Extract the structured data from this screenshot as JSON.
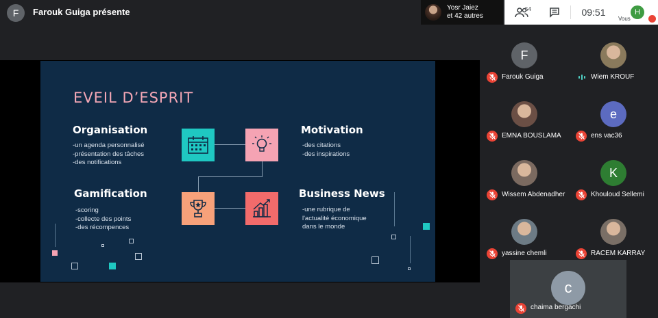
{
  "header": {
    "presenter_initial": "F",
    "presenter_text": "Farouk Guiga présente",
    "people_chip": {
      "line1": "Yosr Jaiez",
      "line2": "et 42 autres"
    },
    "participant_count": "54",
    "clock": "09:51",
    "self": {
      "initial": "H",
      "label": "Vous"
    }
  },
  "slide": {
    "title": "EVEIL D’ESPRIT",
    "sections": [
      {
        "title": "Organisation",
        "lines": [
          "-un agenda personnalisé",
          "-présentation des tâches",
          "-des notifications"
        ]
      },
      {
        "title": "Motivation",
        "lines": [
          "-des citations",
          "-des inspirations"
        ]
      },
      {
        "title": "Gamification",
        "lines": [
          "-scoring",
          "-collecte des points",
          "-des récompences"
        ]
      },
      {
        "title": "Business News",
        "lines": [
          "-une rubrique de",
          "l'actualité économique",
          "dans le monde"
        ]
      }
    ]
  },
  "participants": [
    {
      "name": "Farouk Guiga",
      "initial": "F",
      "avatar_color": "#5f6368",
      "muted": true
    },
    {
      "name": "Wiem KROUF",
      "initial": "",
      "avatar_color": "#8a7a5c",
      "muted": false
    },
    {
      "name": "EMNA BOUSLAMA",
      "initial": "",
      "avatar_color": "#6b4f45",
      "muted": true
    },
    {
      "name": "ens vac36",
      "initial": "e",
      "avatar_color": "#5c6bc0",
      "muted": true
    },
    {
      "name": "Wissem Abdenadher",
      "initial": "",
      "avatar_color": "#7b6a60",
      "muted": true
    },
    {
      "name": "Khouloud Sellemi",
      "initial": "K",
      "avatar_color": "#2e7d32",
      "muted": true
    },
    {
      "name": "yassine chemli",
      "initial": "",
      "avatar_color": "#6d7b85",
      "muted": true
    },
    {
      "name": "RACEM KARRAY",
      "initial": "",
      "avatar_color": "#7a6f66",
      "muted": true
    },
    {
      "name": "chaima bergachi",
      "initial": "c",
      "avatar_color": "#8e9aa6",
      "muted": true
    }
  ],
  "colors": {
    "slide_bg": "#0f2b46",
    "title_pink": "#f4a7b6",
    "icon_teal": "#1fc8c2",
    "icon_pink": "#f5a3b3",
    "icon_orange": "#f7a17a",
    "icon_red": "#f26b6b",
    "mute_red": "#ea4335"
  }
}
